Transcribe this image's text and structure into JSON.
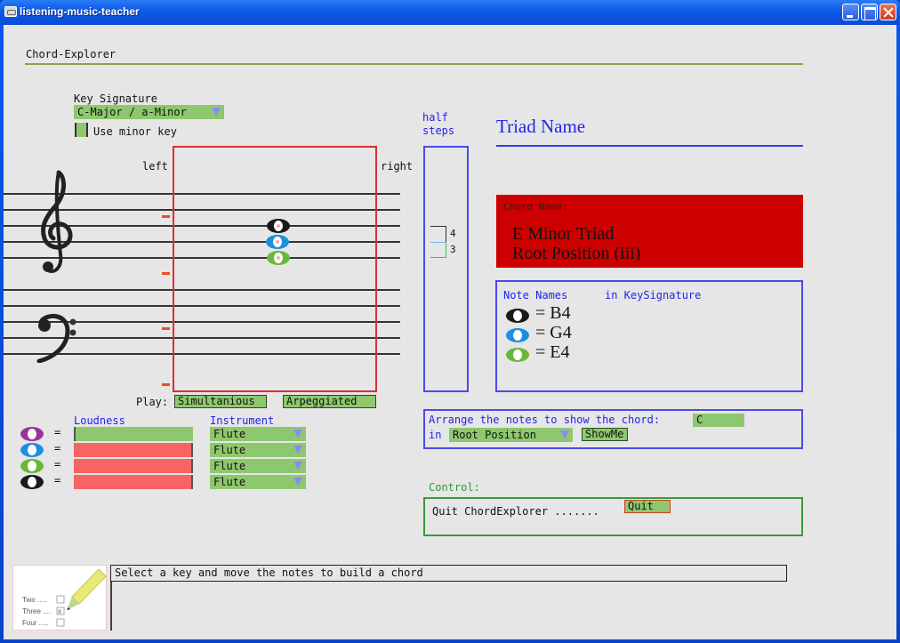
{
  "window": {
    "title": "listening-music-teacher",
    "controls": [
      "minimize",
      "maximize",
      "close"
    ]
  },
  "header": {
    "title": "Chord-Explorer"
  },
  "key_signature": {
    "label": "Key Signature",
    "selected": "C-Major / a-Minor",
    "minor_key_label": "Use minor key",
    "minor_key_checked": false
  },
  "staff": {
    "left_label": "left",
    "right_label": "right",
    "clefs": [
      "treble-clef",
      "bass-clef"
    ],
    "notes": [
      {
        "color_name": "black",
        "color": "#1a1a1a",
        "pitch": "B4"
      },
      {
        "color_name": "blue",
        "color": "#1e8fe0",
        "pitch": "G4"
      },
      {
        "color_name": "green",
        "color": "#6ab83a",
        "pitch": "E4"
      }
    ]
  },
  "play": {
    "label": "Play:",
    "simultaneous_label": "Simultanious",
    "arpeggiated_label": "Arpeggiated"
  },
  "voices": {
    "loudness_header": "Loudness",
    "instrument_header": "Instrument",
    "equals": "=",
    "rows": [
      {
        "color_name": "purple",
        "color": "#993399",
        "loudness": 0,
        "instrument": "Flute"
      },
      {
        "color_name": "blue",
        "color": "#1e8fe0",
        "loudness": 100,
        "instrument": "Flute"
      },
      {
        "color_name": "green",
        "color": "#6ab83a",
        "loudness": 100,
        "instrument": "Flute"
      },
      {
        "color_name": "black",
        "color": "#1a1a1a",
        "loudness": 100,
        "instrument": "Flute"
      }
    ]
  },
  "half_steps": {
    "label_line1": "half",
    "label_line2": "steps",
    "intervals": [
      "4",
      "3"
    ]
  },
  "triad": {
    "title": "Triad Name",
    "chord_name_label": "Chord Name:",
    "chord_line1": "E Minor Triad",
    "chord_line2": "Root Position  (iii)"
  },
  "note_names": {
    "header_left": "Note Names",
    "header_right": "in KeySignature",
    "equals": "=",
    "items": [
      {
        "color_name": "black",
        "color": "#1a1a1a",
        "name": "B4"
      },
      {
        "color_name": "blue",
        "color": "#1e8fe0",
        "name": "G4"
      },
      {
        "color_name": "green",
        "color": "#6ab83a",
        "name": "E4"
      }
    ]
  },
  "arrange": {
    "prompt": "Arrange the notes to show the chord:",
    "chord_value": "C",
    "in_label": "in",
    "position_selected": "Root Position",
    "showme_label": "ShowMe"
  },
  "control": {
    "label": "Control:",
    "quit_text": "Quit ChordExplorer .......",
    "quit_button": "Quit"
  },
  "status": {
    "message": "Select a key and move the notes to build a chord",
    "logo_labels": [
      "Two",
      "Three",
      "Four"
    ]
  },
  "colors": {
    "accent_green": "#8ec86e",
    "chord_red": "#cc0000",
    "loud_red": "#f76464",
    "label_blue": "#2222ee"
  }
}
